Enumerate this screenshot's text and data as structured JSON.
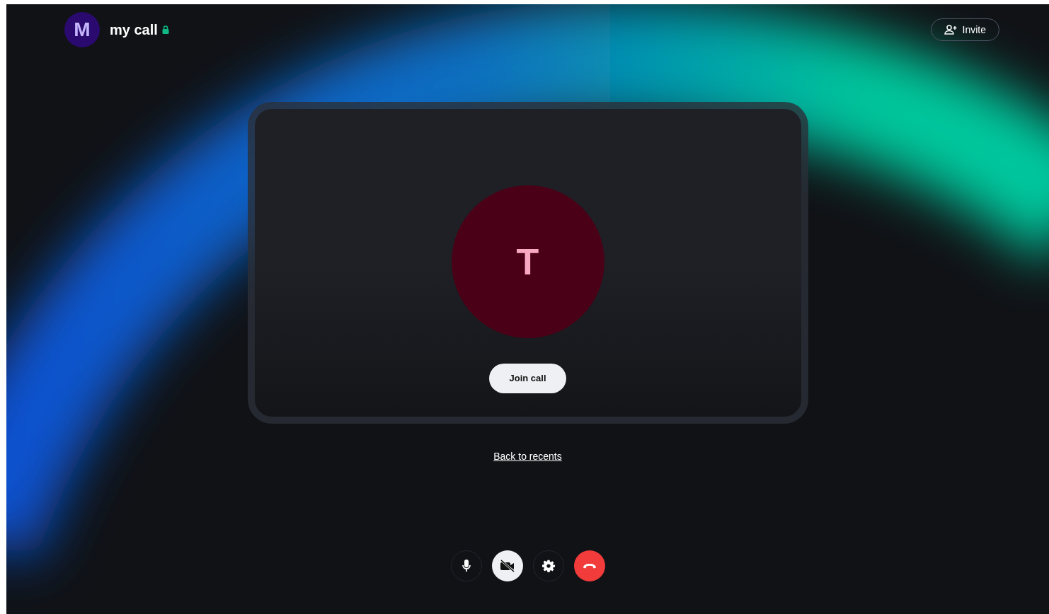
{
  "header": {
    "avatar_letter": "M",
    "title": "my call",
    "locked": true,
    "invite_label": "Invite"
  },
  "tile": {
    "avatar_letter": "T",
    "join_label": "Join call"
  },
  "back_link": "Back to recents",
  "controls": [
    {
      "kind": "mic",
      "active": false
    },
    {
      "kind": "camera",
      "active": true
    },
    {
      "kind": "settings",
      "active": false
    },
    {
      "kind": "hangup",
      "active": false
    }
  ]
}
